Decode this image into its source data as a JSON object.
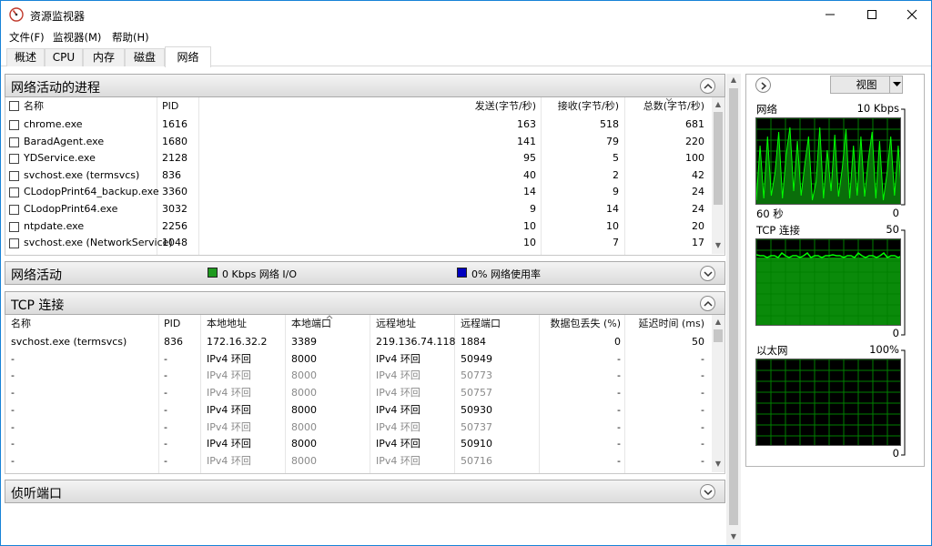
{
  "window": {
    "title": "资源监视器",
    "colors": {
      "accent": "#1883d7",
      "graph_bg": "#000000",
      "graph_grid": "#008000",
      "graph_line": "#00ff00",
      "network_legend": "#1f9a1f",
      "usage_legend": "#0000c0"
    }
  },
  "menu": [
    "文件(F)",
    "监视器(M)",
    "帮助(H)"
  ],
  "tabs": [
    "概述",
    "CPU",
    "内存",
    "磁盘",
    "网络"
  ],
  "active_tab": "网络",
  "processes": {
    "title": "网络活动的进程",
    "columns": [
      "名称",
      "PID",
      "发送(字节/秒)",
      "接收(字节/秒)",
      "总数(字节/秒)"
    ],
    "rows": [
      [
        "chrome.exe",
        "1616",
        "163",
        "518",
        "681"
      ],
      [
        "BaradAgent.exe",
        "1680",
        "141",
        "79",
        "220"
      ],
      [
        "YDService.exe",
        "2128",
        "95",
        "5",
        "100"
      ],
      [
        "svchost.exe (termsvcs)",
        "836",
        "40",
        "2",
        "42"
      ],
      [
        "CLodopPrint64_backup.exe",
        "3360",
        "14",
        "9",
        "24"
      ],
      [
        "CLodopPrint64.exe",
        "3032",
        "9",
        "14",
        "24"
      ],
      [
        "ntpdate.exe",
        "2256",
        "10",
        "10",
        "20"
      ],
      [
        "svchost.exe (NetworkService)",
        "1048",
        "10",
        "7",
        "17"
      ]
    ]
  },
  "network_activity": {
    "title": "网络活动",
    "io_label": "0 Kbps 网络 I/O",
    "usage_label": "0% 网络使用率"
  },
  "tcp": {
    "title": "TCP 连接",
    "columns": [
      "名称",
      "PID",
      "本地地址",
      "本地端口",
      "远程地址",
      "远程端口",
      "数据包丢失 (%)",
      "延迟时间 (ms)"
    ],
    "rows": [
      {
        "cells": [
          "svchost.exe (termsvcs)",
          "836",
          "172.16.32.2",
          "3389",
          "219.136.74.118",
          "1884",
          "0",
          "50"
        ],
        "gray": false
      },
      {
        "cells": [
          "-",
          "-",
          "IPv4 环回",
          "8000",
          "IPv4 环回",
          "50949",
          "-",
          "-"
        ],
        "gray": false
      },
      {
        "cells": [
          "-",
          "-",
          "IPv4 环回",
          "8000",
          "IPv4 环回",
          "50773",
          "-",
          "-"
        ],
        "gray": true
      },
      {
        "cells": [
          "-",
          "-",
          "IPv4 环回",
          "8000",
          "IPv4 环回",
          "50757",
          "-",
          "-"
        ],
        "gray": true
      },
      {
        "cells": [
          "-",
          "-",
          "IPv4 环回",
          "8000",
          "IPv4 环回",
          "50930",
          "-",
          "-"
        ],
        "gray": false
      },
      {
        "cells": [
          "-",
          "-",
          "IPv4 环回",
          "8000",
          "IPv4 环回",
          "50737",
          "-",
          "-"
        ],
        "gray": true
      },
      {
        "cells": [
          "-",
          "-",
          "IPv4 环回",
          "8000",
          "IPv4 环回",
          "50910",
          "-",
          "-"
        ],
        "gray": false
      },
      {
        "cells": [
          "-",
          "-",
          "IPv4 环回",
          "8000",
          "IPv4 环回",
          "50716",
          "-",
          "-"
        ],
        "gray": true
      }
    ]
  },
  "listening": {
    "title": "侦听端口"
  },
  "right_panel": {
    "view_label": "视图",
    "graphs": [
      {
        "name": "网络",
        "scale": "10 Kbps",
        "left_foot": "60 秒",
        "right_foot": "0"
      },
      {
        "name": "TCP 连接",
        "scale": "50",
        "left_foot": "",
        "right_foot": "0"
      },
      {
        "name": "以太网",
        "scale": "100%",
        "left_foot": "",
        "right_foot": "0"
      }
    ]
  }
}
